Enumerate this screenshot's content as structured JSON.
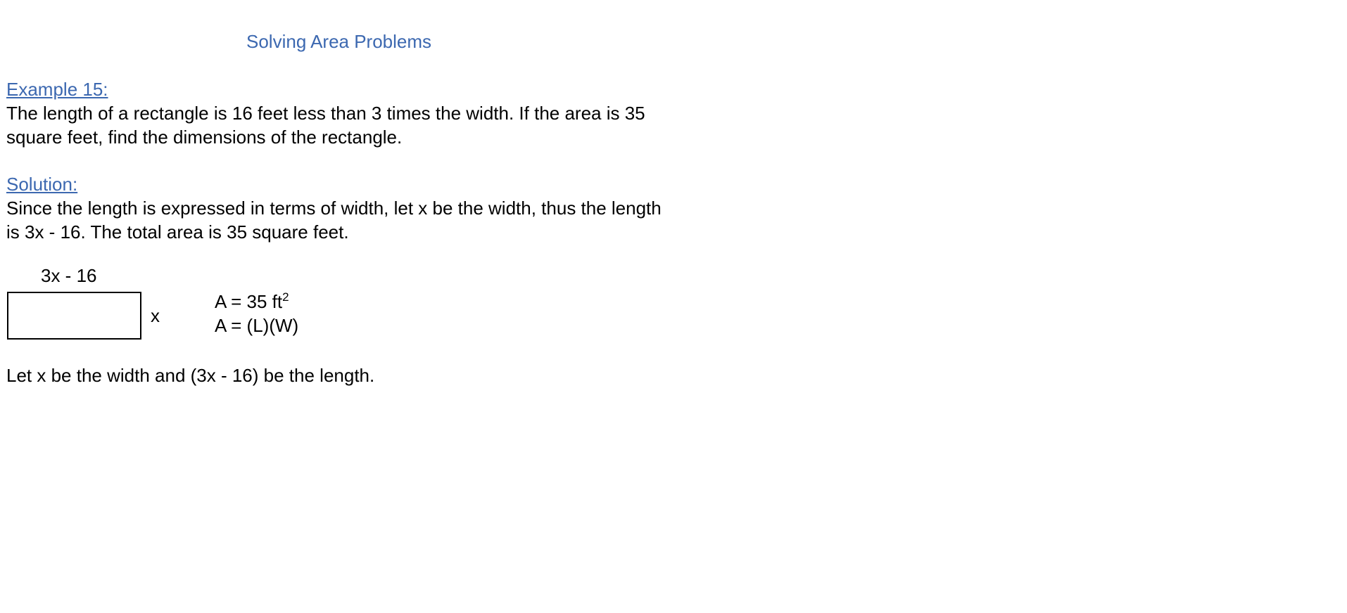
{
  "title": "Solving Area Problems",
  "example": {
    "heading": "Example 15:",
    "lines": [
      "The length of a rectangle is 16 feet less than 3 times the width.  If the area is 35",
      "square feet, find the dimensions of the rectangle."
    ]
  },
  "solution": {
    "heading": "Solution:",
    "lines": [
      "Since the length is expressed in terms of width, let x be the width, thus the length",
      "is 3x - 16.   The total area is 35 square feet."
    ]
  },
  "diagram": {
    "length_label": "3x - 16",
    "width_label": "x"
  },
  "formulas": {
    "area_value_prefix": "A = 35 ft",
    "area_value_exponent": "2",
    "area_formula": "A = (L)(W)"
  },
  "conclusion": "Let x be the width and (3x - 16) be the length."
}
